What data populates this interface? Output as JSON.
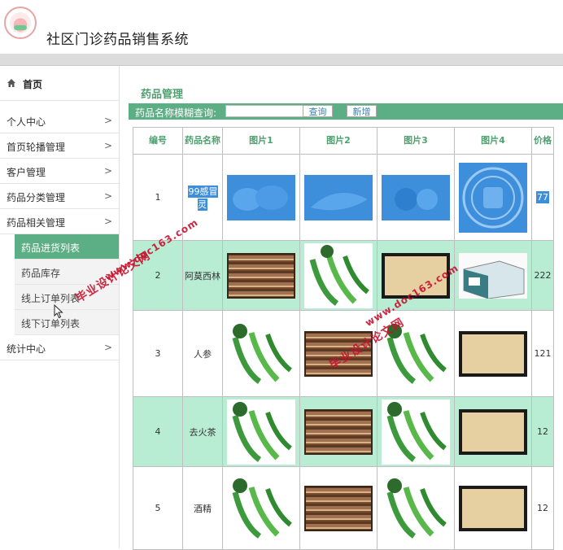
{
  "app": {
    "title": "社区门诊药品销售系统"
  },
  "sidebar": {
    "home": "首页",
    "items": [
      {
        "label": "个人中心",
        "arrow": ">"
      },
      {
        "label": "首页轮播管理",
        "arrow": ">"
      },
      {
        "label": "客户管理",
        "arrow": ">"
      },
      {
        "label": "药品分类管理",
        "arrow": ">"
      },
      {
        "label": "药品相关管理",
        "arrow": ">"
      }
    ],
    "subitems": [
      {
        "label": "药品进货列表",
        "active": true
      },
      {
        "label": "药品库存"
      },
      {
        "label": "线上订单列表"
      },
      {
        "label": "线下订单列表"
      }
    ],
    "stats": {
      "label": "统计中心",
      "arrow": ">"
    }
  },
  "main": {
    "title": "药品管理",
    "search": {
      "label": "药品名称模糊查询:",
      "value": "",
      "query_button": "查询",
      "add_button": "新增"
    },
    "columns": [
      "编号",
      "药品名称",
      "图片1",
      "图片2",
      "图片3",
      "图片4",
      "价格"
    ],
    "rows": [
      {
        "id": "1",
        "name": "99感冒灵",
        "price": "77",
        "images": [
          "blue-bread",
          "blue-peas",
          "blue-veg",
          "manchester-united-logo"
        ]
      },
      {
        "id": "2",
        "name": "阿莫西林",
        "price": "222",
        "images": [
          "bookshelf",
          "green-peppers",
          "old-book",
          "medicine-box"
        ]
      },
      {
        "id": "3",
        "name": "人参",
        "price": "121",
        "images": [
          "green-peppers",
          "bookshelf",
          "green-peppers",
          "old-book"
        ]
      },
      {
        "id": "4",
        "name": "去火茶",
        "price": "12",
        "images": [
          "green-peppers",
          "bookshelf",
          "green-peppers",
          "old-book"
        ]
      },
      {
        "id": "5",
        "name": "酒精",
        "price": "12",
        "images": [
          "green-peppers",
          "bookshelf",
          "green-peppers",
          "old-book"
        ]
      }
    ]
  },
  "watermarks": [
    {
      "line1": "毕业设计论文网",
      "line2": "www.doc163.com"
    },
    {
      "line1": "毕业设计论文网",
      "line2": "www.doc163.com"
    }
  ],
  "colors": {
    "accent": "#5cae84",
    "row_alt": "#b8ecd3",
    "header_text": "#4fa06f",
    "selection": "#3d8fdc"
  }
}
